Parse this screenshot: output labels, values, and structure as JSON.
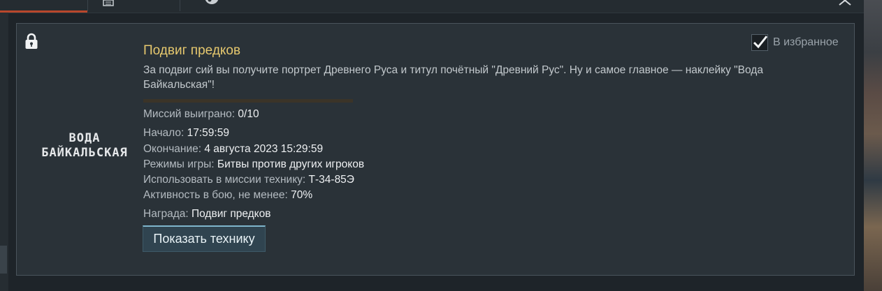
{
  "window": {
    "close_icon": "close-icon"
  },
  "card": {
    "title": "Подвиг предков",
    "description": "За подвиг сий вы получите портрет Древнего Руса и титул почётный \"Древний Рус\". Ну и самое главное — наклейку \"Вода Байкальская\"!",
    "progress_fraction": 0,
    "sticker": {
      "line1": "ВОДА",
      "line2": "БАЙКАЛЬСКАЯ"
    },
    "favorite": {
      "label": "В избранное",
      "checked": true
    },
    "missions_won": {
      "label": "Миссий выиграно: ",
      "value": "0/10"
    },
    "start": {
      "label": "Начало: ",
      "value": "17:59:59"
    },
    "end": {
      "label": "Окончание: ",
      "value": "4 августа 2023 15:29:59"
    },
    "modes": {
      "label": "Режимы игры: ",
      "value": "Битвы против других игроков"
    },
    "vehicle": {
      "label": "Использовать в миссии технику: ",
      "value": "Т-34-85Э"
    },
    "activity": {
      "label": "Активность в бою, не менее: ",
      "value": "70%"
    },
    "reward": {
      "label": "Награда: ",
      "value": "Подвиг предков"
    },
    "show_vehicle_button": "Показать технику"
  },
  "colors": {
    "title": "#e6c86e",
    "accent_tab": "#b9472c",
    "button": "#304450"
  }
}
